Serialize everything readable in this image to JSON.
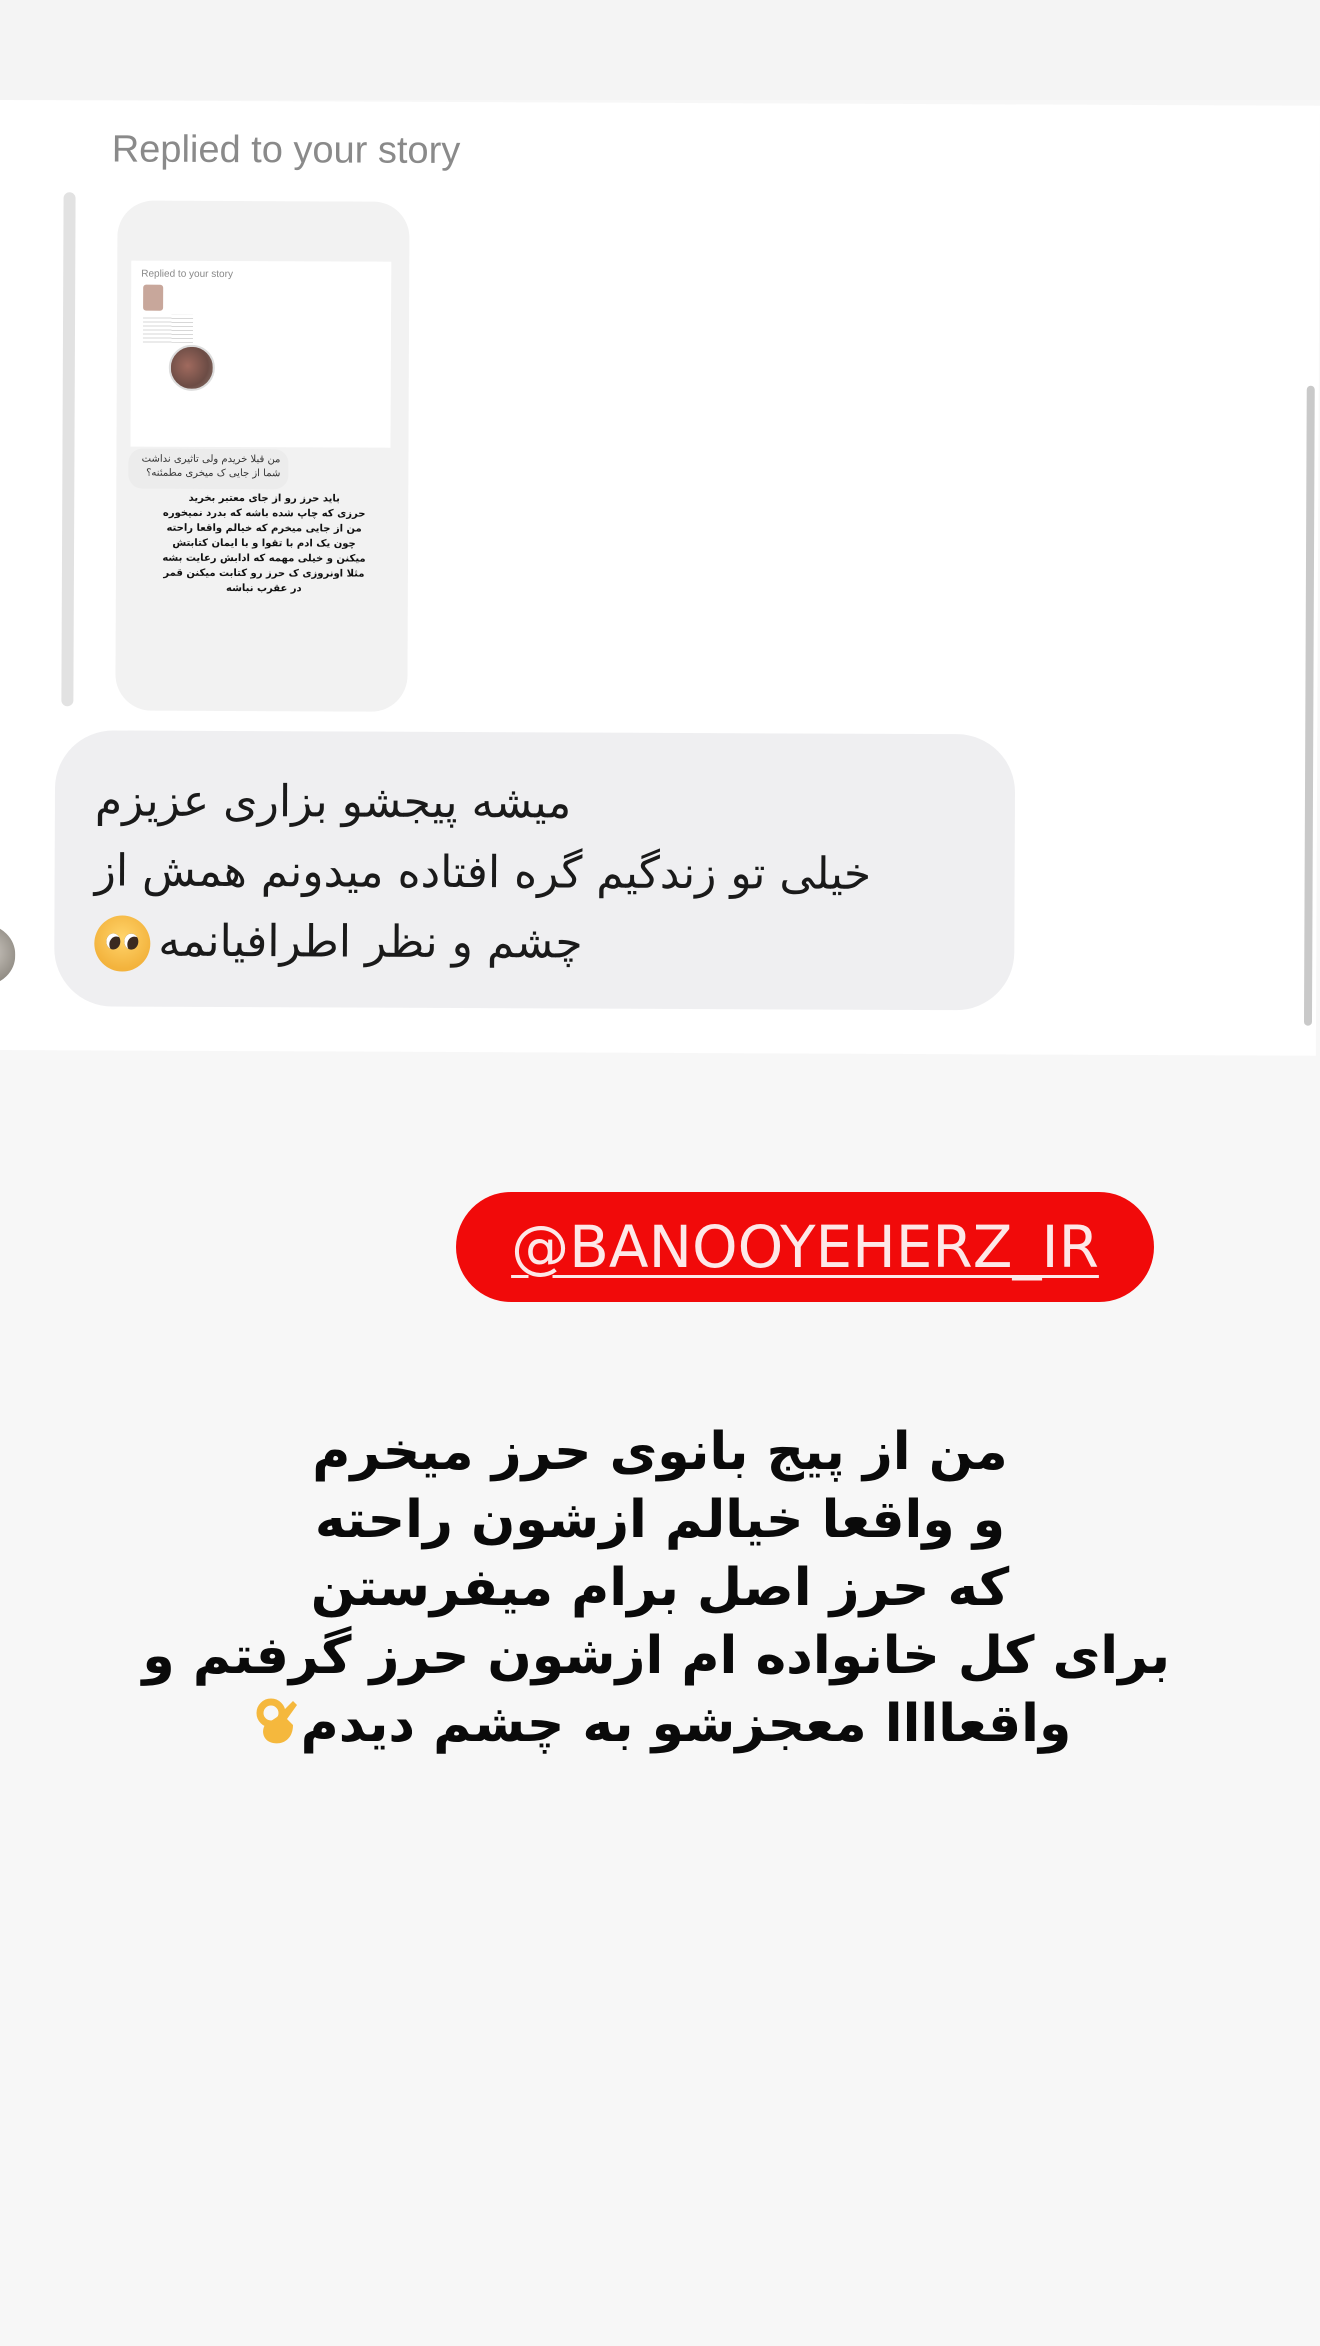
{
  "story_reply": {
    "label": "Replied to your story",
    "thumbnail": {
      "inner_label": "Replied to your story",
      "inner_bubble": "من قبلا خریدم ولی تاثیری نداشت\nشما از جایی ک میخری مطمئنه؟",
      "inner_text": "باید حرز رو از جای معتبر بخرید\nحرزی که چاپ شده باشه که بدرد نمیخوره\nمن از جایی میخرم که خیالم واقعا راحته\nچون یک ادم با تقوا و با ایمان کتابتش\nمیکنن و خیلی مهمه که ادابش رعایت بشه\nمثلا اونروزی ک حرز رو کتابت میکنن قمر\nدر عقرب نباشه"
    }
  },
  "message": {
    "lines": [
      "میشه پیجشو بزاری عزیزم",
      "خیلی تو زندگیم گره افتاده میدونم همش از",
      "چشم و نظر اطرافیانمه"
    ],
    "emoji": "pleading-face-icon"
  },
  "mention": {
    "handle": "@BANOOYEHERZ_IR",
    "color": "#f10a0a"
  },
  "caption": {
    "lines": [
      "من از پیج بانوی حرز میخرم",
      "و واقعا خیالم ازشون راحته",
      "که حرز اصل برام میفرستن",
      "برای کل خانواده ام ازشون حرز گرفتم و",
      "واقعاااا معجزشو به چشم دیدم"
    ],
    "emoji": "ok-hand-icon"
  }
}
